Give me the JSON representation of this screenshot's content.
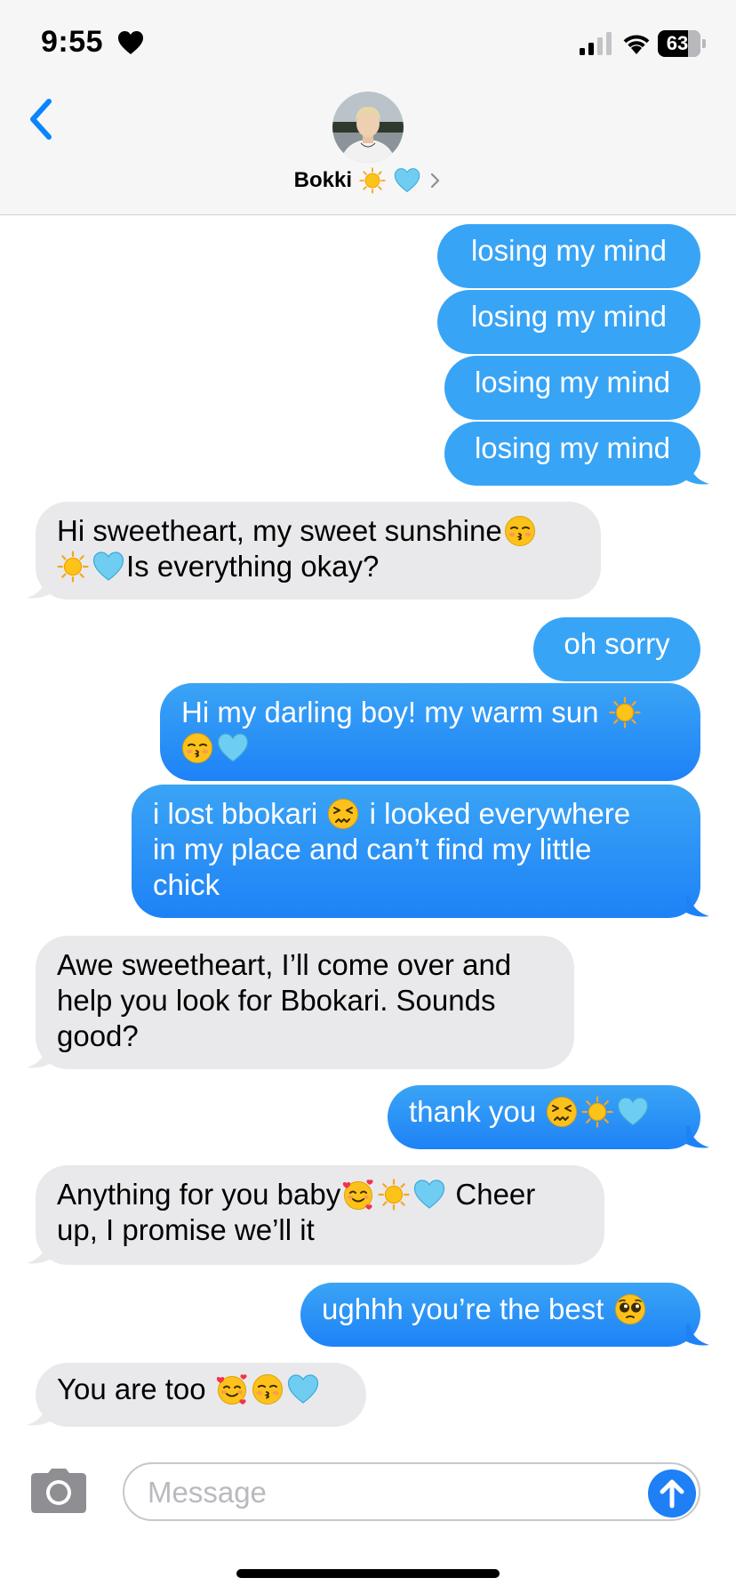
{
  "status_bar": {
    "time": "9:55",
    "battery": "63",
    "icons": [
      "heart-icon",
      "signal-icon",
      "wifi-icon",
      "battery-icon"
    ]
  },
  "header": {
    "contact_name": "Bokki",
    "contact_emojis": [
      "sun-emoji",
      "light-blue-heart-emoji"
    ],
    "back_icon": "chevron-left-icon",
    "detail_icon": "chevron-right-icon"
  },
  "messages": [
    {
      "from": "me",
      "text": "losing my mind"
    },
    {
      "from": "me",
      "text": "losing my mind"
    },
    {
      "from": "me",
      "text": "losing my mind"
    },
    {
      "from": "me",
      "text": "losing my mind"
    },
    {
      "from": "them",
      "line1": "Hi sweetheart, my sweet sunshine",
      "line2": "Is everything okay?"
    },
    {
      "from": "me",
      "text": "oh sorry"
    },
    {
      "from": "me",
      "line1": "Hi my darling boy! my warm sun"
    },
    {
      "from": "me",
      "line1a": "i lost bbokari",
      "line1b": "i looked everywhere",
      "line2": "in my place and can’t find my little",
      "line3": "chick"
    },
    {
      "from": "them",
      "line1": "Awe sweetheart, I’ll come over and",
      "line2": "help you look for Bbokari. Sounds",
      "line3": "good?"
    },
    {
      "from": "me",
      "text": "thank you"
    },
    {
      "from": "them",
      "line1a": "Anything for you baby",
      "line1b": "Cheer",
      "line2": "up, I promise we’ll it"
    },
    {
      "from": "me",
      "text": "ughhh you’re the best"
    },
    {
      "from": "them",
      "text": "You are too"
    }
  ],
  "input": {
    "placeholder": "Message",
    "camera_icon": "camera-icon",
    "send_icon": "send-arrow-icon"
  },
  "colors": {
    "outgoing_bubble": "#1e82f7",
    "incoming_bubble": "#e9e9eb",
    "accent": "#0a84ff"
  }
}
